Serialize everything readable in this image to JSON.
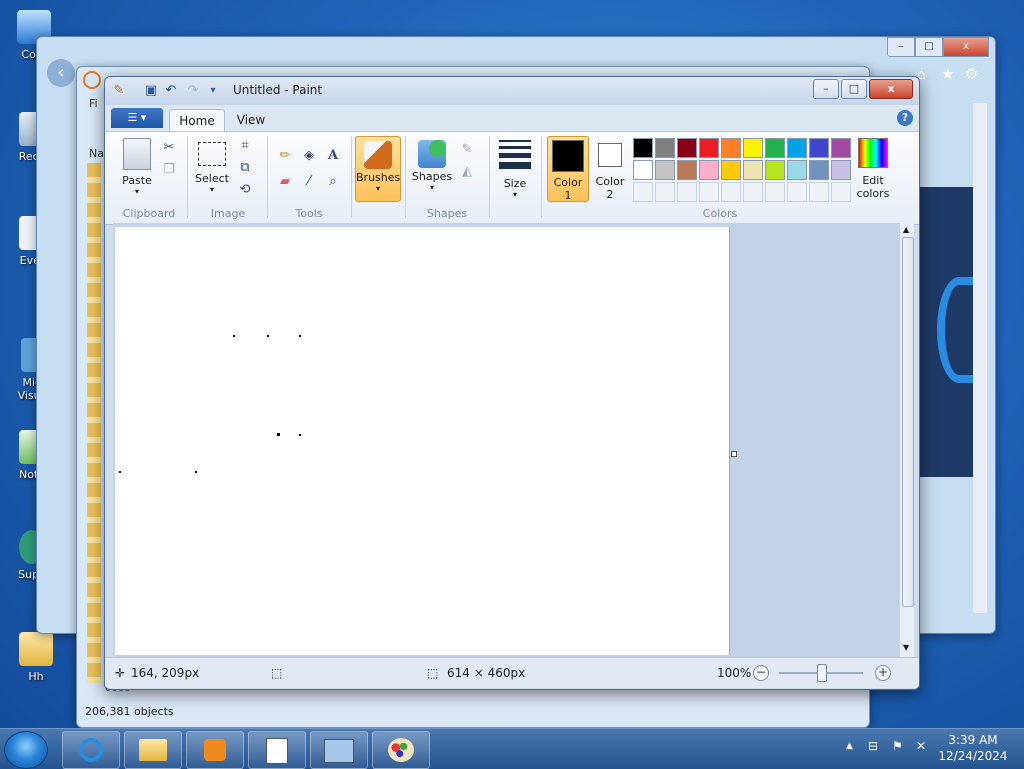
{
  "desktop": {
    "icons": [
      {
        "label": "Com"
      },
      {
        "label": "Recy"
      },
      {
        "label": "Ever"
      },
      {
        "label": "Micr\nVisual"
      },
      {
        "label": "Note"
      },
      {
        "label": "Supe"
      },
      {
        "label": "Hh"
      }
    ]
  },
  "background_explorer": {
    "status": "206,381 objects",
    "menu_initial": "Fi",
    "column_initial": "Na",
    "last_row": "0000"
  },
  "paint": {
    "title": "Untitled - Paint",
    "quick_access": {
      "save": "save-icon",
      "undo": "undo-icon",
      "redo": "redo-icon",
      "customize": "▾"
    },
    "window_controls": {
      "minimize": "–",
      "maximize": "□",
      "close": "x"
    },
    "file_tab_icon": "menu-icon",
    "tabs": [
      {
        "label": "Home",
        "active": true
      },
      {
        "label": "View",
        "active": false
      }
    ],
    "ribbon": {
      "clipboard": {
        "group": "Clipboard",
        "paste": "Paste"
      },
      "image": {
        "group": "Image",
        "select": "Select"
      },
      "tools": {
        "group": "Tools"
      },
      "brushes": {
        "label": "Brushes"
      },
      "shapes": {
        "group": "Shapes",
        "label": "Shapes"
      },
      "size": {
        "label": "Size"
      },
      "colors": {
        "group": "Colors",
        "color1_line1": "Color",
        "color1_line2": "1",
        "color2_line1": "Color",
        "color2_line2": "2",
        "edit_line1": "Edit",
        "edit_line2": "colors",
        "primary": "#000000",
        "secondary": "#ffffff",
        "row1": [
          "#000000",
          "#7f7f7f",
          "#880015",
          "#ed1c24",
          "#ff7f27",
          "#fff200",
          "#22b14c",
          "#00a2e8",
          "#3f48cc",
          "#a349a4"
        ],
        "row2": [
          "#ffffff",
          "#c3c3c3",
          "#b97a57",
          "#ffaec9",
          "#ffc90e",
          "#efe4b0",
          "#b5e61d",
          "#99d9ea",
          "#7092be",
          "#c8bfe7"
        ]
      }
    },
    "status": {
      "position": "164, 209px",
      "canvas_size": "614 × 460px",
      "zoom": "100%"
    }
  },
  "taskbar": {
    "time": "3:39 AM",
    "date": "12/24/2024",
    "apps": [
      "ie-icon",
      "explorer-icon",
      "media-player-icon",
      "notepad-icon",
      "remote-desktop-icon",
      "paint-icon"
    ]
  }
}
